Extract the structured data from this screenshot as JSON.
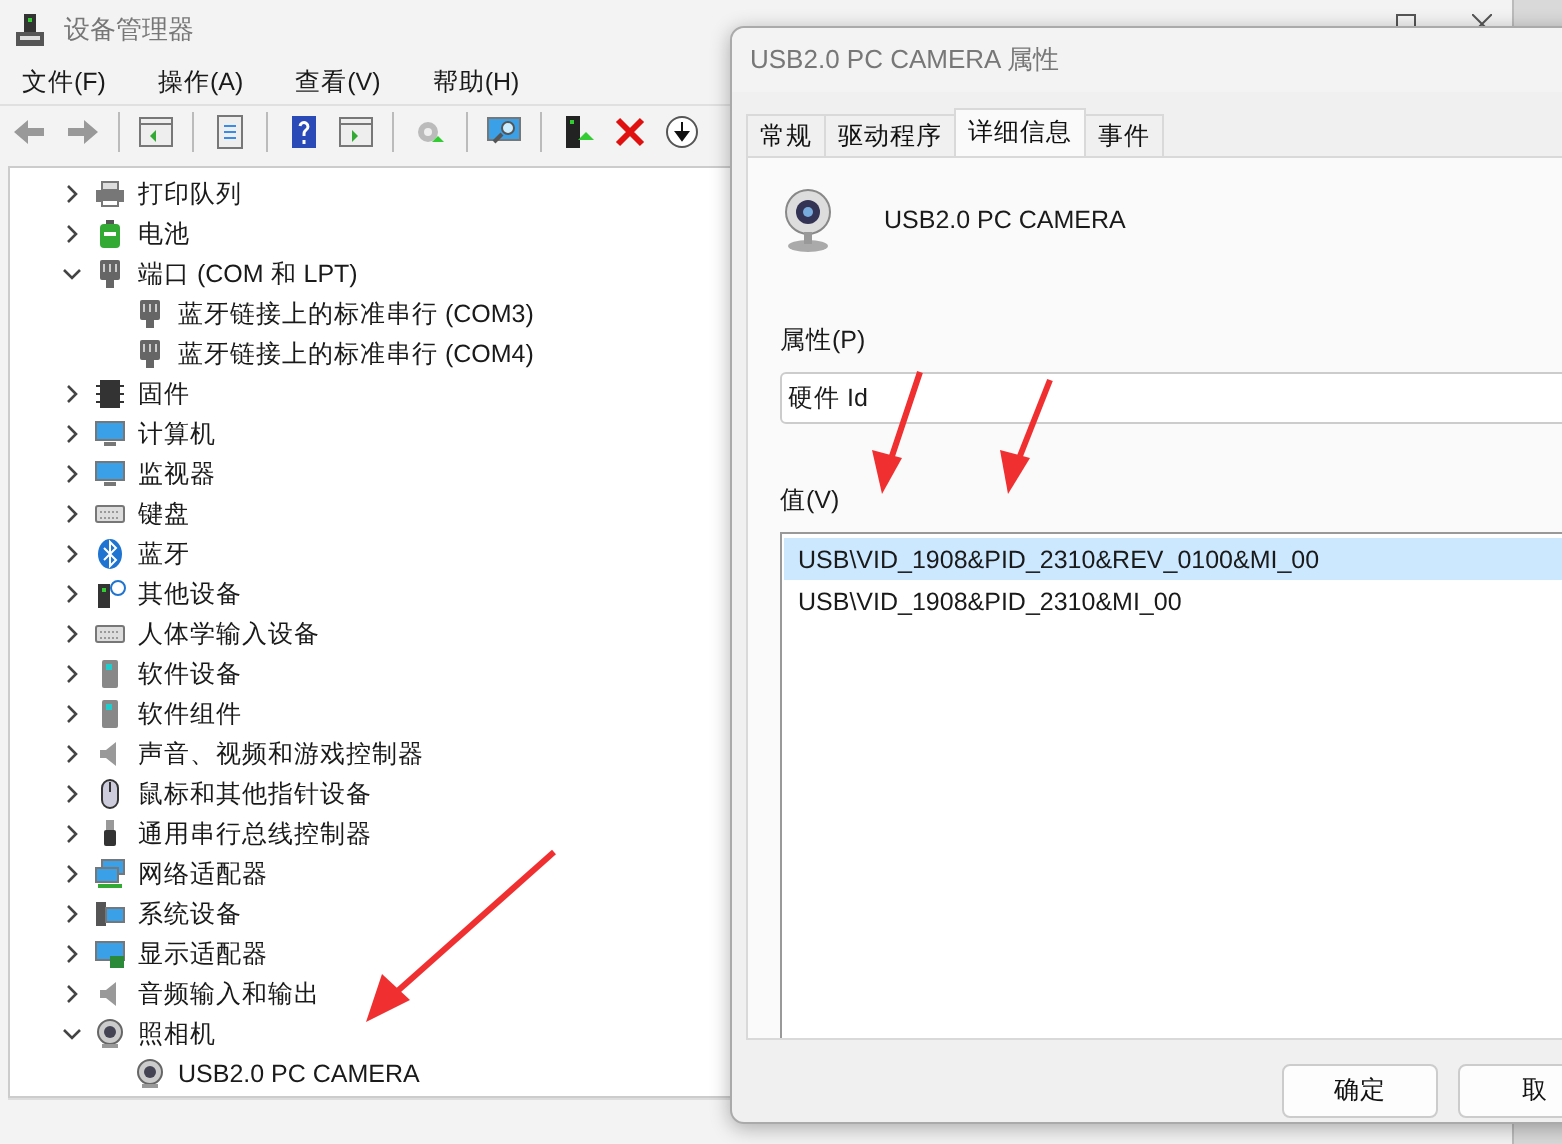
{
  "device_manager": {
    "title": "设备管理器",
    "menu": [
      "文件(F)",
      "操作(A)",
      "查看(V)",
      "帮助(H)"
    ],
    "tree": [
      {
        "label": "打印队列",
        "expanded": false
      },
      {
        "label": "电池",
        "expanded": false
      },
      {
        "label": "端口 (COM 和 LPT)",
        "expanded": true,
        "children": [
          {
            "label": "蓝牙链接上的标准串行 (COM3)"
          },
          {
            "label": "蓝牙链接上的标准串行 (COM4)"
          }
        ]
      },
      {
        "label": "固件",
        "expanded": false
      },
      {
        "label": "计算机",
        "expanded": false
      },
      {
        "label": "监视器",
        "expanded": false
      },
      {
        "label": "键盘",
        "expanded": false
      },
      {
        "label": "蓝牙",
        "expanded": false
      },
      {
        "label": "其他设备",
        "expanded": false
      },
      {
        "label": "人体学输入设备",
        "expanded": false
      },
      {
        "label": "软件设备",
        "expanded": false
      },
      {
        "label": "软件组件",
        "expanded": false
      },
      {
        "label": "声音、视频和游戏控制器",
        "expanded": false
      },
      {
        "label": "鼠标和其他指针设备",
        "expanded": false
      },
      {
        "label": "通用串行总线控制器",
        "expanded": false
      },
      {
        "label": "网络适配器",
        "expanded": false
      },
      {
        "label": "系统设备",
        "expanded": false
      },
      {
        "label": "显示适配器",
        "expanded": false
      },
      {
        "label": "音频输入和输出",
        "expanded": false
      },
      {
        "label": "照相机",
        "expanded": true,
        "children": [
          {
            "label": "USB2.0 PC CAMERA"
          }
        ]
      }
    ]
  },
  "dialog": {
    "title": "USB2.0 PC CAMERA 属性",
    "tabs": [
      {
        "label": "常规",
        "selected": false
      },
      {
        "label": "驱动程序",
        "selected": false
      },
      {
        "label": "详细信息",
        "selected": true
      },
      {
        "label": "事件",
        "selected": false
      }
    ],
    "device_name": "USB2.0 PC CAMERA",
    "property_label": "属性(P)",
    "property_value": "硬件 Id",
    "value_label": "值(V)",
    "values": [
      {
        "text": "USB\\VID_1908&PID_2310&REV_0100&MI_00",
        "selected": true
      },
      {
        "text": "USB\\VID_1908&PID_2310&MI_00",
        "selected": false
      }
    ],
    "buttons": [
      "确定",
      "取"
    ]
  }
}
